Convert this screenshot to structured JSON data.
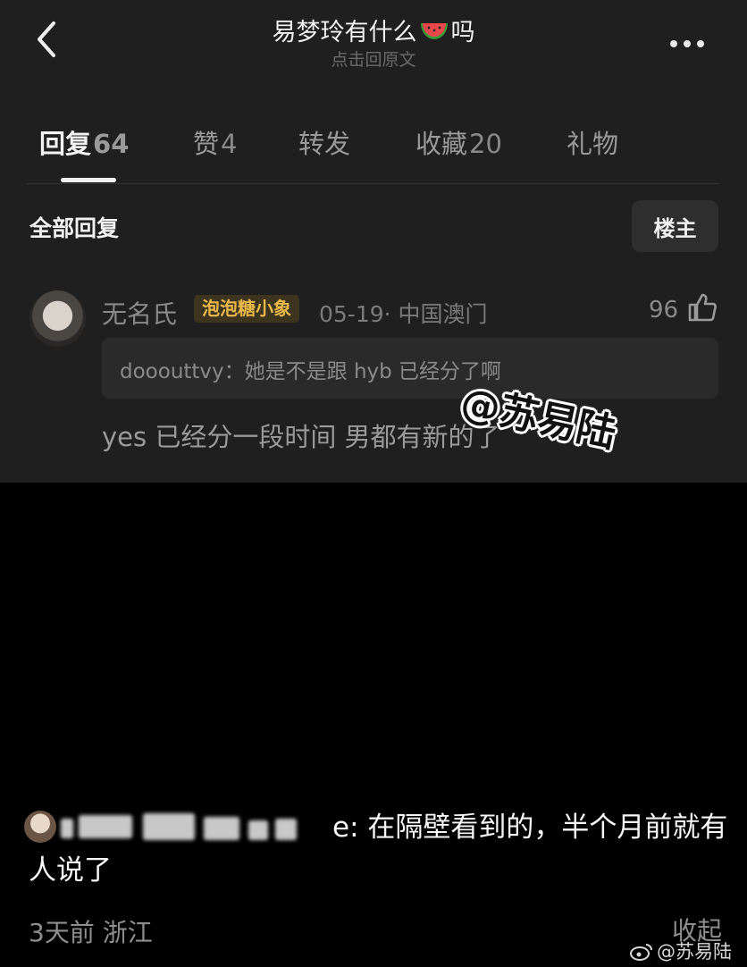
{
  "header": {
    "title_before": "易梦玲有什么",
    "title_emoji": "watermelon-emoji",
    "title_after": "吗",
    "subtitle": "点击回原文",
    "back_icon": "chevron-left-icon",
    "more_icon": "more-dots-icon"
  },
  "tabs": [
    {
      "label": "回复",
      "count": "64",
      "active": true
    },
    {
      "label": "赞",
      "count": "4",
      "active": false
    },
    {
      "label": "转发",
      "count": "",
      "active": false
    },
    {
      "label": "收藏",
      "count": "20",
      "active": false
    },
    {
      "label": "礼物",
      "count": "",
      "active": false
    }
  ],
  "section": {
    "title": "全部回复",
    "owner_button": "楼主"
  },
  "reply": {
    "username": "无名氏",
    "badge": "泡泡糖小象",
    "meta": "05-19· 中国澳门",
    "likes": "96",
    "quote": "dooouttvy：她是不是跟 hyb 已经分了啊",
    "text": "yes 已经分一段时间 男都有新的了"
  },
  "watermark": "@苏易陆",
  "comment": {
    "name_suffix": "e",
    "text": ": 在隔壁看到的，半个月前就有人说了",
    "time": "3天前 浙江",
    "collapse": "收起"
  },
  "weibo_watermark": "@苏易陆",
  "colors": {
    "panel_bg": "#1f1f1f",
    "page_bg": "#000000",
    "badge_text": "#e8b94a"
  }
}
